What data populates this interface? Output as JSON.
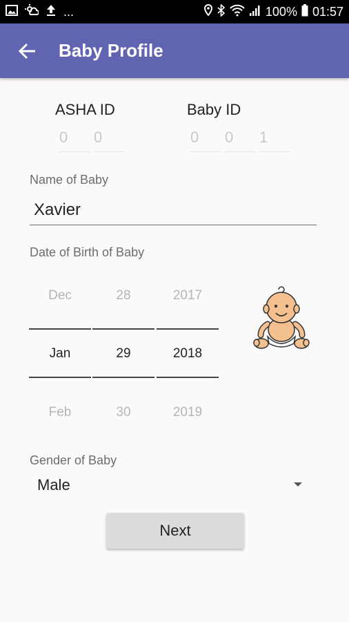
{
  "status_bar": {
    "icons_left": [
      "image-icon",
      "cloud-sun-icon",
      "upload-icon"
    ],
    "overflow": "...",
    "battery": "100%",
    "time": "01:57"
  },
  "app_bar": {
    "title": "Baby Profile"
  },
  "ids": {
    "asha_label": "ASHA ID",
    "asha_digits": [
      "0",
      "0"
    ],
    "baby_label": "Baby ID",
    "baby_digits": [
      "0",
      "0",
      "1"
    ]
  },
  "name": {
    "label": "Name of Baby",
    "value": "Xavier"
  },
  "dob": {
    "label": "Date of Birth of Baby",
    "months": {
      "prev": "Dec",
      "selected": "Jan",
      "next": "Feb"
    },
    "days": {
      "prev": "28",
      "selected": "29",
      "next": "30"
    },
    "years": {
      "prev": "2017",
      "selected": "2018",
      "next": "2019"
    }
  },
  "gender": {
    "label": "Gender of Baby",
    "value": "Male"
  },
  "next_button": {
    "label": "Next"
  },
  "colors": {
    "app_bar": "#6164b0",
    "status_bar": "#000000",
    "button_bg": "#dcdcdc"
  }
}
